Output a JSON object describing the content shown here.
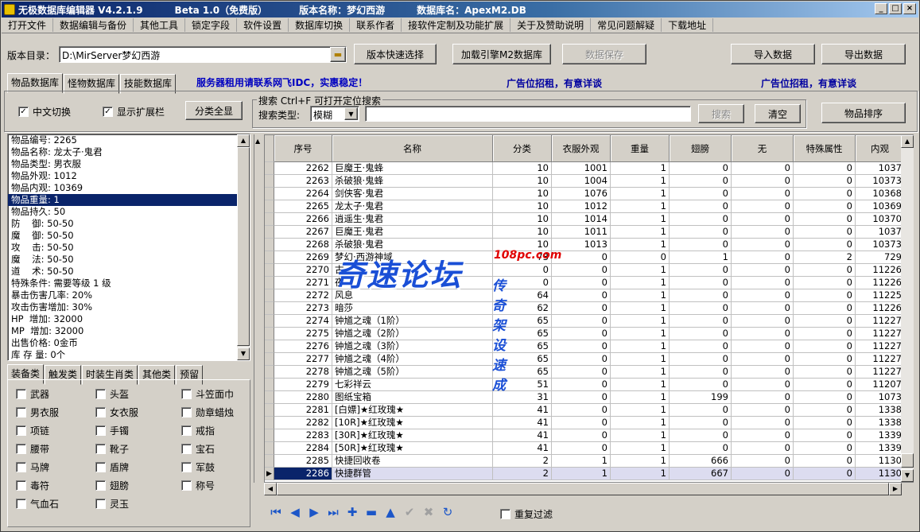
{
  "title": {
    "app": "无极数据库编辑器 V4.2.1.9",
    "beta": "Beta 1.0（免费版）",
    "version_label": "版本名称：梦幻西游",
    "db_label": "数据库名：ApexM2.DB"
  },
  "menu": [
    "打开文件",
    "数据编辑与备份",
    "其他工具",
    "锁定字段",
    "软件设置",
    "数据库切换",
    "联系作者",
    "接软件定制及功能扩展",
    "关于及赞助说明",
    "常见问题解疑",
    "下载地址"
  ],
  "toolbar": {
    "dir_label": "版本目录：",
    "dir_value": "D:\\MirServer梦幻西游",
    "quick_select": "版本快速选择",
    "load_engine": "加载引擎M2数据库",
    "save": "数据保存",
    "import": "导入数据",
    "export": "导出数据"
  },
  "tabs": [
    "物品数据库",
    "怪物数据库",
    "技能数据库"
  ],
  "ads": {
    "ad1": "服务器租用请联系网飞IDC，实惠稳定！",
    "ad2": "广告位招租，有意详谈",
    "ad3": "广告位招租，有意详谈"
  },
  "options": {
    "chinese": "中文切换",
    "show_ext": "显示扩展栏",
    "show_all": "分类全显"
  },
  "search": {
    "group": "搜索  Ctrl+F 可打开定位搜索",
    "type_label": "搜索类型:",
    "type_value": "模糊",
    "search_btn": "搜索",
    "clear_btn": "清空",
    "sort_btn": "物品排序"
  },
  "props": [
    "物品编号: 2265",
    "物品名称: 龙太子·鬼君",
    "物品类型: 男衣服",
    "物品外观: 1012",
    "物品内观: 10369",
    "物品重量: 1",
    "物品持久: 50",
    "防    御: 50-50",
    "魔    御: 50-50",
    "攻    击: 50-50",
    "魔    法: 50-50",
    "道    术: 50-50",
    "特殊条件: 需要等级 1 级",
    "暴击伤害几率: 20%",
    "攻击伤害增加: 30%",
    "HP  增加: 32000",
    "MP  增加: 32000",
    "出售价格: 0金币",
    "库 存 量: 0个"
  ],
  "props_selected_index": 5,
  "cat_tabs": [
    "装备类",
    "触发类",
    "时装生肖类",
    "其他类",
    "预留"
  ],
  "categories": [
    [
      "武器",
      "头盔",
      "斗笠面巾"
    ],
    [
      "男衣服",
      "女衣服",
      "勋章蜡烛"
    ],
    [
      "项链",
      "手镯",
      "戒指"
    ],
    [
      "腰带",
      "靴子",
      "宝石"
    ],
    [
      "马牌",
      "盾牌",
      "军鼓"
    ],
    [
      "毒符",
      "翅膀",
      "称号"
    ],
    [
      "气血石",
      "灵玉",
      ""
    ]
  ],
  "grid": {
    "headers": [
      "序号",
      "名称",
      "分类",
      "衣服外观",
      "重量",
      "翅膀",
      "无",
      "特殊属性",
      "内观"
    ],
    "rows": [
      [
        "2262",
        "巨魔王·鬼蜂",
        "10",
        "1001",
        "1",
        "0",
        "0",
        "0",
        "1037"
      ],
      [
        "2263",
        "杀破狼·鬼蜂",
        "10",
        "1004",
        "1",
        "0",
        "0",
        "0",
        "10373"
      ],
      [
        "2264",
        "剑侠客·鬼君",
        "10",
        "1076",
        "1",
        "0",
        "0",
        "0",
        "10368"
      ],
      [
        "2265",
        "龙太子·鬼君",
        "10",
        "1012",
        "1",
        "0",
        "0",
        "0",
        "10369"
      ],
      [
        "2266",
        "逍遥生·鬼君",
        "10",
        "1014",
        "1",
        "0",
        "0",
        "0",
        "10370"
      ],
      [
        "2267",
        "巨魔王·鬼君",
        "10",
        "1011",
        "1",
        "0",
        "0",
        "0",
        "1037"
      ],
      [
        "2268",
        "杀破狼·鬼君",
        "10",
        "1013",
        "1",
        "0",
        "0",
        "0",
        "10373"
      ],
      [
        "2269",
        "梦幻·西游神域",
        "73",
        "0",
        "0",
        "1",
        "0",
        "2",
        "729"
      ],
      [
        "2270",
        "古",
        "0",
        "0",
        "1",
        "0",
        "0",
        "0",
        "11226"
      ],
      [
        "2271",
        "夜",
        "0",
        "0",
        "1",
        "0",
        "0",
        "0",
        "11226"
      ],
      [
        "2272",
        "风息",
        "64",
        "0",
        "1",
        "0",
        "0",
        "0",
        "11225"
      ],
      [
        "2273",
        "暗莎",
        "62",
        "0",
        "1",
        "0",
        "0",
        "0",
        "11226"
      ],
      [
        "2274",
        "钟馗之魂（1阶）",
        "65",
        "0",
        "1",
        "0",
        "0",
        "0",
        "11227"
      ],
      [
        "2275",
        "钟馗之魂（2阶）",
        "65",
        "0",
        "1",
        "0",
        "0",
        "0",
        "11227"
      ],
      [
        "2276",
        "钟馗之魂（3阶）",
        "65",
        "0",
        "1",
        "0",
        "0",
        "0",
        "11227"
      ],
      [
        "2277",
        "钟馗之魂（4阶）",
        "65",
        "0",
        "1",
        "0",
        "0",
        "0",
        "11227"
      ],
      [
        "2278",
        "钟馗之魂（5阶）",
        "65",
        "0",
        "1",
        "0",
        "0",
        "0",
        "11227"
      ],
      [
        "2279",
        "七彩祥云",
        "51",
        "0",
        "1",
        "0",
        "0",
        "0",
        "11207"
      ],
      [
        "2280",
        "图纸宝箱",
        "31",
        "0",
        "1",
        "199",
        "0",
        "0",
        "1073"
      ],
      [
        "2281",
        "[白嫖]★红玫瑰★",
        "41",
        "0",
        "1",
        "0",
        "0",
        "0",
        "1338"
      ],
      [
        "2282",
        "[10R]★红玫瑰★",
        "41",
        "0",
        "1",
        "0",
        "0",
        "0",
        "1338"
      ],
      [
        "2283",
        "[30R]★红玫瑰★",
        "41",
        "0",
        "1",
        "0",
        "0",
        "0",
        "1339"
      ],
      [
        "2284",
        "[50R]★红玫瑰★",
        "41",
        "0",
        "1",
        "0",
        "0",
        "0",
        "1339"
      ],
      [
        "2285",
        "快捷回收卷",
        "2",
        "1",
        "1",
        "666",
        "0",
        "0",
        "1130"
      ],
      [
        "2286",
        "快捷群管",
        "2",
        "1",
        "1",
        "667",
        "0",
        "0",
        "1130"
      ]
    ],
    "selected_index": 24
  },
  "dup_filter": "重复过滤",
  "watermark": {
    "main": "奇速论坛",
    "domain": "108pc.com",
    "sub": "传奇架设速成"
  }
}
